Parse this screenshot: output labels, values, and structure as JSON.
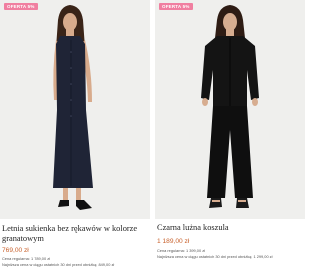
{
  "colors": {
    "badge": "#f07fa0",
    "price": "#c8612c",
    "background": "#efefed"
  },
  "products": [
    {
      "badge": "OFERTA 5%",
      "name": "Letnia sukienka bez rękawów w kolorze granatowym",
      "price": "769,00 zł",
      "regular_price": "Cena regularna: 1 789,00 zł",
      "lowest_price": "Najniższa cena w ciągu ostatnich 30 dni przed obniżką: 849,00 zł"
    },
    {
      "badge": "OFERTA 5%",
      "name": "Czarna lużna koszula",
      "price": "1 189,00 zł",
      "regular_price": "Cena regularna: 1 399,00 zł",
      "lowest_price": "Najniższa cena w ciągu ostatnich 30 dni przed obniżką: 1 299,00 zł"
    }
  ]
}
